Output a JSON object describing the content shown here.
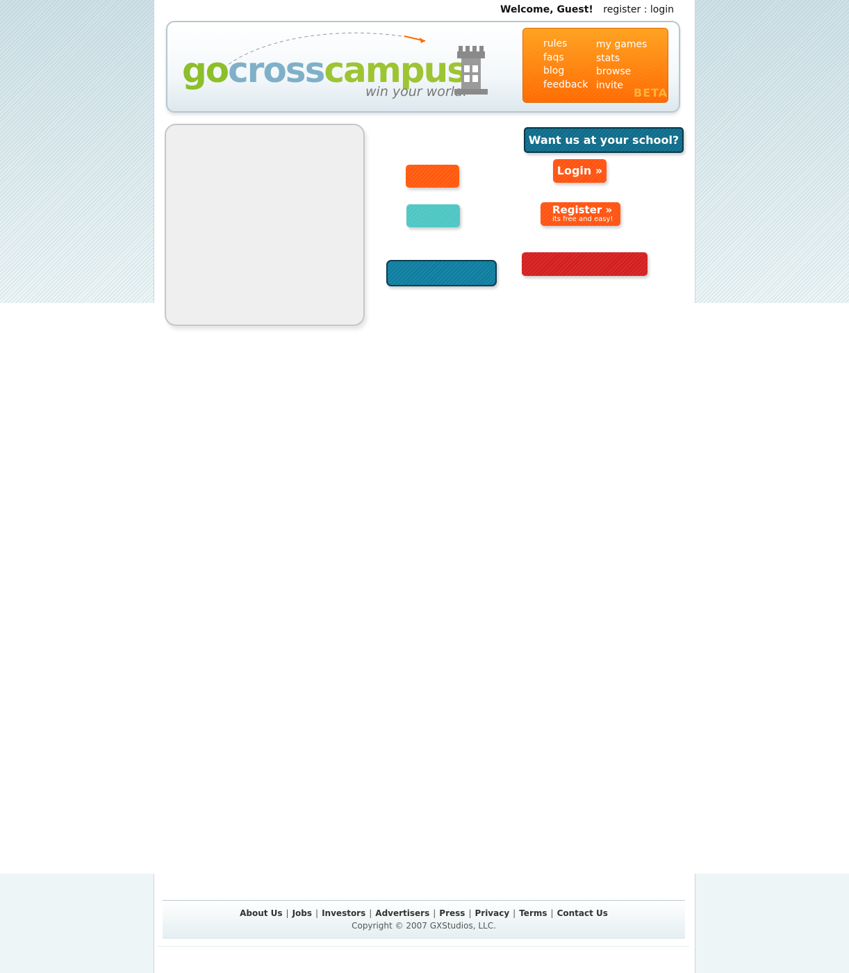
{
  "topbar": {
    "welcome": "Welcome, Guest!",
    "register": "register",
    "separator": " : ",
    "login": "login"
  },
  "header": {
    "logo_go": "go",
    "logo_cross": "cross",
    "logo_campus": "campus",
    "tagline": "win your world.",
    "nav": {
      "col1": [
        "rules",
        "faqs",
        "blog",
        "feedback"
      ],
      "col2": [
        "my games",
        "stats",
        "browse",
        "invite"
      ],
      "badge": "BETA"
    }
  },
  "buttons": {
    "school": "Want us at your school? »",
    "login": "Login »",
    "register": "Register »",
    "register_sub": "its free and easy!"
  },
  "footer": {
    "links": [
      "About Us",
      "Jobs",
      "Investors",
      "Advertisers",
      "Press",
      "Privacy",
      "Terms",
      "Contact Us"
    ],
    "separator": "|",
    "copyright": "Copyright © 2007 GXStudios, LLC."
  },
  "colors": {
    "brand_orange": "#ff6a00",
    "brand_green": "#9dc433",
    "brand_blue": "#0f6c8a",
    "alert_red": "#d42020",
    "teal": "#4ec6c4"
  }
}
